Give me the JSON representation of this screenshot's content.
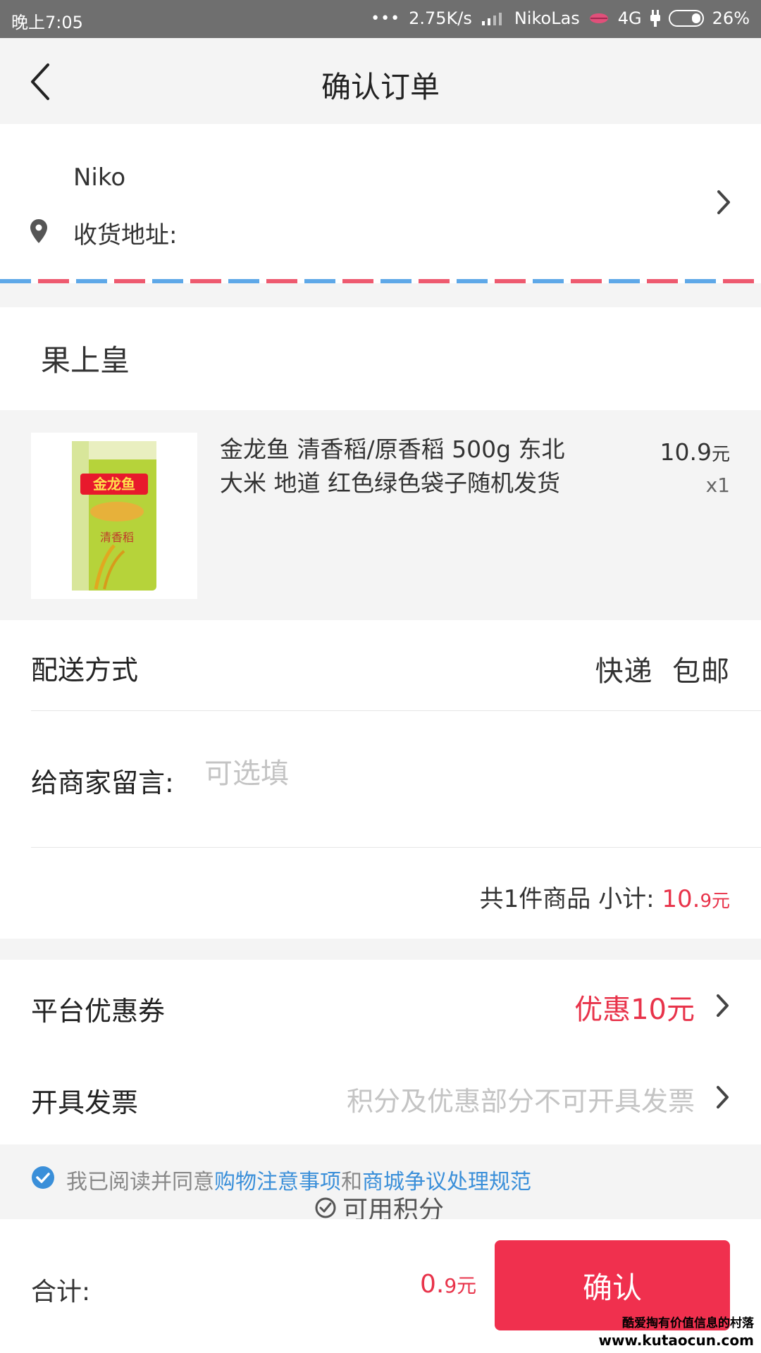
{
  "status_bar": {
    "time": "晚上7:05",
    "dots": "•••",
    "speed": "2.75K/s",
    "carrier": "NikoLas",
    "network": "4G",
    "battery": "26%"
  },
  "header": {
    "title": "确认订单"
  },
  "address": {
    "name": "Niko",
    "label": "收货地址:"
  },
  "shop": {
    "name": "果上皇"
  },
  "product": {
    "title": "金龙鱼 清香稻/原香稻 500g 东北大米 地道 红色绿色袋子随机发货",
    "price_num": "10.9",
    "price_unit": "元",
    "qty": "x1",
    "image_brand": "金龙鱼",
    "image_sub": "清香稻"
  },
  "delivery": {
    "label": "配送方式",
    "value": "快递  包邮"
  },
  "message": {
    "label": "给商家留言:",
    "placeholder": "可选填",
    "value": ""
  },
  "summary": {
    "text": "共1件商品 小计:",
    "amount_main": "10.",
    "amount_small": "9元"
  },
  "coupon": {
    "label": "平台优惠券",
    "value": "优惠10元"
  },
  "invoice": {
    "label": "开具发票",
    "value": "积分及优惠部分不可开具发票"
  },
  "agreement": {
    "prefix": "我已阅读并同意",
    "link1": "购物注意事项",
    "conjunction": "和",
    "link2": "商城争议处理规范"
  },
  "points": {
    "label": "可用积分"
  },
  "footer": {
    "total_label": "合计:",
    "total_main": "0.",
    "total_small": "9元",
    "confirm_label": "确认"
  },
  "watermark": {
    "line1": "酷爱掏有价值信息的村落",
    "line2": "www.kutaocun.com"
  },
  "colors": {
    "accent": "#f0304e",
    "price_red": "#e8334a",
    "link_blue": "#3a8fd9",
    "mail_red": "#ee5a6f",
    "mail_blue": "#5ea8e8"
  }
}
